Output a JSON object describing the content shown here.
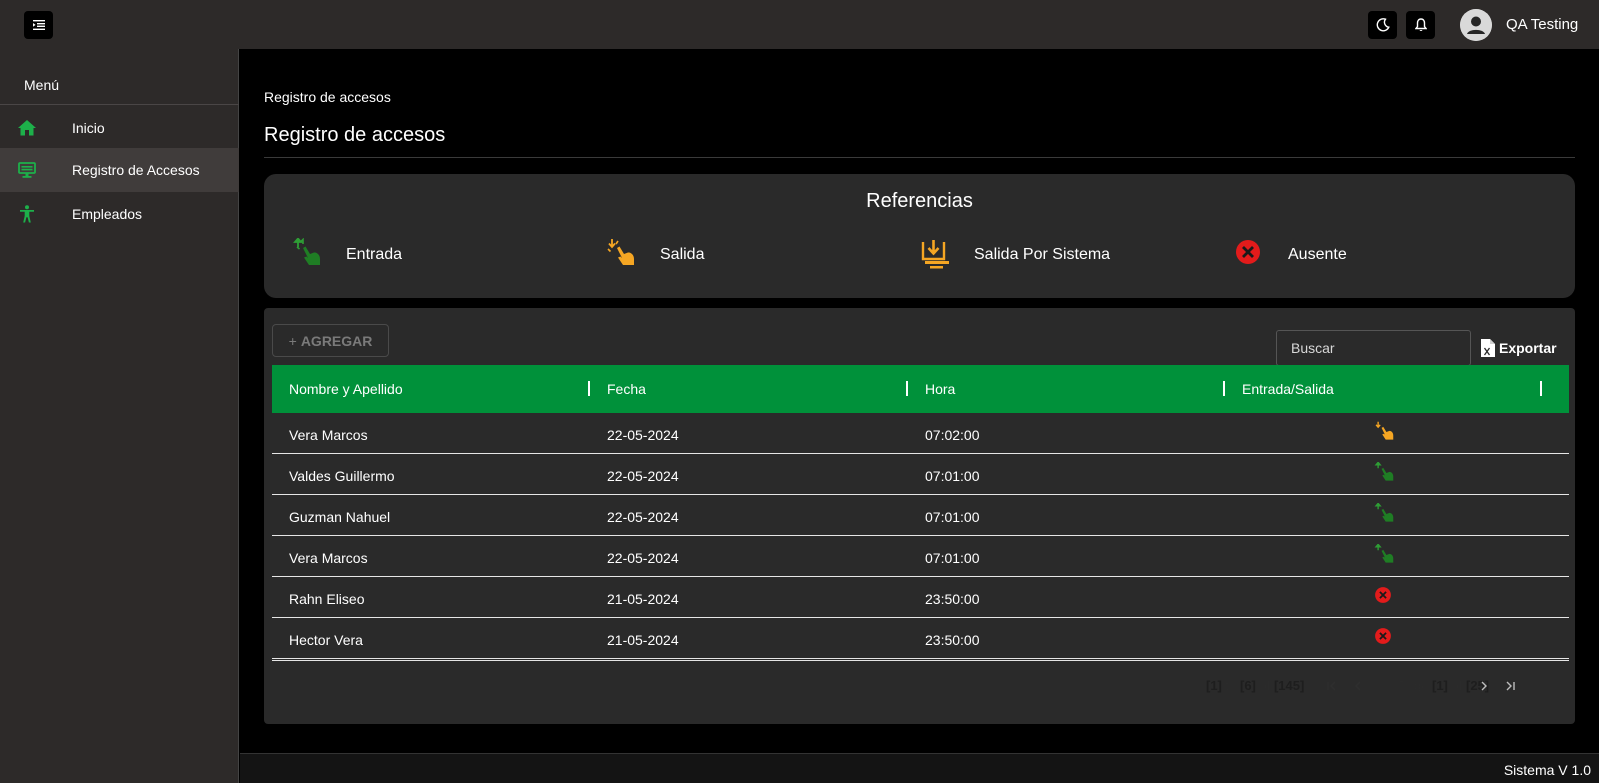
{
  "header": {
    "user_name": "QA Testing",
    "icons": [
      "menu-toggle-icon",
      "moon-icon",
      "bell-icon",
      "user-avatar-icon"
    ]
  },
  "sidebar": {
    "title": "Menú",
    "items": [
      {
        "label": "Inicio",
        "icon": "home-icon",
        "active": false
      },
      {
        "label": "Registro de Accesos",
        "icon": "desktop-icon",
        "active": true
      },
      {
        "label": "Empleados",
        "icon": "person-icon",
        "active": false
      }
    ]
  },
  "main": {
    "breadcrumb": "Registro de accesos",
    "title": "Registro de accesos"
  },
  "references": {
    "title": "Referencias",
    "items": [
      {
        "label": "Entrada",
        "icon": "entry-hand-icon",
        "color": "#2e9e35"
      },
      {
        "label": "Salida",
        "icon": "exit-hand-icon",
        "color": "#f5a623"
      },
      {
        "label": "Salida Por Sistema",
        "icon": "system-exit-icon",
        "color": "#f5a623"
      },
      {
        "label": "Ausente",
        "icon": "absent-x-icon",
        "color": "#e31b1b"
      }
    ]
  },
  "table": {
    "add_label": "AGREGAR",
    "search_placeholder": "Buscar",
    "export_label": "Exportar",
    "columns": [
      "Nombre y Apellido",
      "Fecha",
      "Hora",
      "Entrada/Salida"
    ],
    "rows": [
      {
        "name": "Vera Marcos",
        "date": "22-05-2024",
        "time": "07:02:00",
        "status": "salida"
      },
      {
        "name": "Valdes Guillermo",
        "date": "22-05-2024",
        "time": "07:01:00",
        "status": "entrada"
      },
      {
        "name": "Guzman Nahuel",
        "date": "22-05-2024",
        "time": "07:01:00",
        "status": "entrada"
      },
      {
        "name": "Vera Marcos",
        "date": "22-05-2024",
        "time": "07:01:00",
        "status": "entrada"
      },
      {
        "name": "Rahn Eliseo",
        "date": "21-05-2024",
        "time": "23:50:00",
        "status": "ausente"
      },
      {
        "name": "Hector Vera",
        "date": "21-05-2024",
        "time": "23:50:00",
        "status": "ausente"
      }
    ],
    "pagination": {
      "from": "[1]",
      "to_word": "to",
      "to": "[6]",
      "of_word": "of",
      "total": "[145]",
      "page_word": "Page",
      "page": "[1]",
      "pages": "[25]"
    }
  },
  "footer": {
    "text": "Sistema V 1.0"
  },
  "colors": {
    "accent_green": "#00913a",
    "entry": "#2e9e35",
    "exit": "#f5a623",
    "absent": "#e31b1b"
  }
}
